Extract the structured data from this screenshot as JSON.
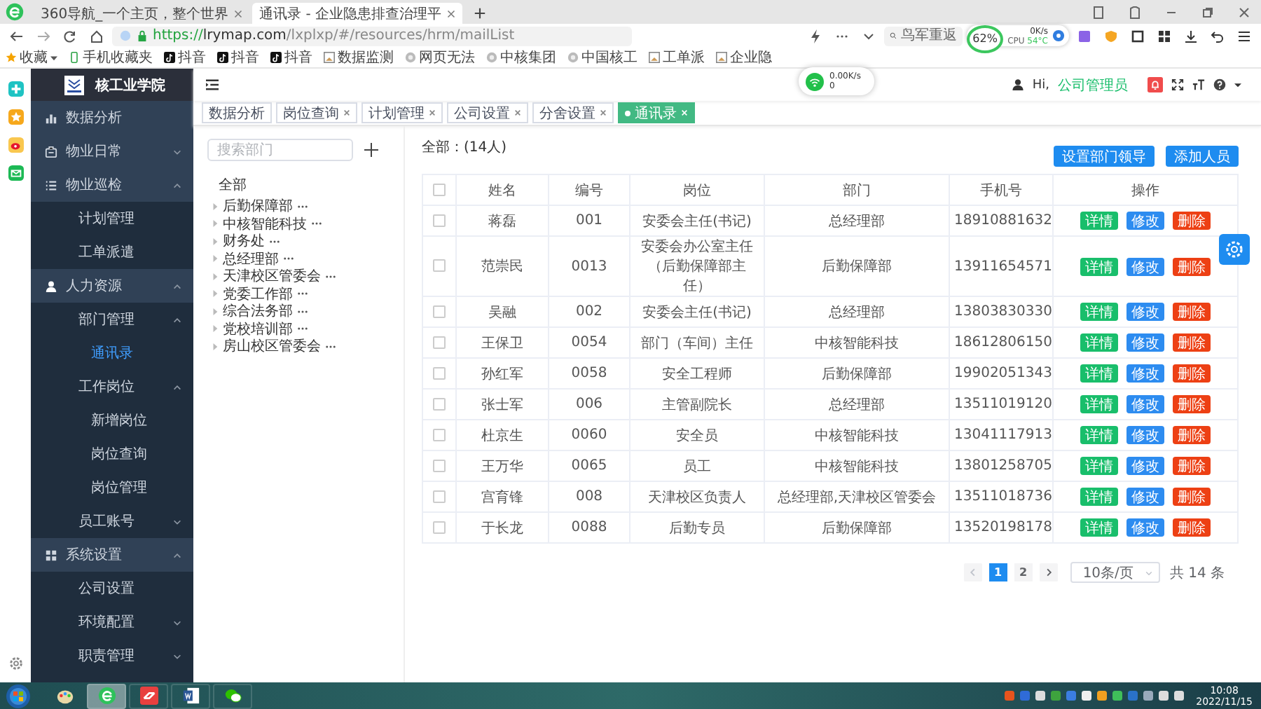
{
  "browser": {
    "tabs": [
      {
        "title": "360导航_一个主页，整个世界",
        "selected": false
      },
      {
        "title": "通讯录 - 企业隐患排查治理平",
        "selected": true
      }
    ],
    "url_scheme": "https://",
    "url_host": "lrymap.com",
    "url_path": "/lxplxp/#/resources/hrm/mailList",
    "search_placeholder": "鸟军重返",
    "monitor": {
      "percent": "62%",
      "speed": "0K/s",
      "cpu": "CPU",
      "temp": "54°C"
    },
    "bookmarks": [
      "收藏",
      "手机收藏夹",
      "抖音",
      "抖音",
      "抖音",
      "数据监测",
      "网页无法",
      "中核集团",
      "中国核工",
      "工单派",
      "企业隐"
    ]
  },
  "net_widget": {
    "speed": "0.00K/s",
    "count": "0"
  },
  "app": {
    "logo": "核工业学院",
    "sidebar": [
      {
        "label": "数据分析",
        "selected": false
      },
      {
        "label": "物业日常",
        "expanded": false,
        "selected": false
      },
      {
        "label": "物业巡检",
        "expanded": true,
        "selected": false,
        "children": [
          {
            "label": "计划管理",
            "selected": false
          },
          {
            "label": "工单派遣",
            "selected": false
          }
        ]
      },
      {
        "label": "人力资源",
        "expanded": true,
        "selected": false,
        "children": [
          {
            "label": "部门管理",
            "expanded": true,
            "selected": false,
            "children": [
              {
                "label": "通讯录",
                "selected": true
              }
            ]
          },
          {
            "label": "工作岗位",
            "expanded": true,
            "selected": false,
            "children": [
              {
                "label": "新增岗位",
                "selected": false
              },
              {
                "label": "岗位查询",
                "selected": false
              },
              {
                "label": "岗位管理",
                "selected": false
              }
            ]
          },
          {
            "label": "员工账号",
            "expanded": false,
            "selected": false
          }
        ]
      },
      {
        "label": "系统设置",
        "expanded": true,
        "selected": false,
        "children": [
          {
            "label": "公司设置",
            "selected": false
          },
          {
            "label": "环境配置",
            "expanded": false,
            "selected": false
          },
          {
            "label": "职责管理",
            "expanded": false,
            "selected": false
          }
        ]
      }
    ],
    "header": {
      "greeting": "Hi,",
      "user": "公司管理员"
    },
    "tags": [
      {
        "label": "数据分析",
        "closable": false,
        "selected": false
      },
      {
        "label": "岗位查询",
        "closable": true,
        "selected": false
      },
      {
        "label": "计划管理",
        "closable": true,
        "selected": false
      },
      {
        "label": "公司设置",
        "closable": true,
        "selected": false
      },
      {
        "label": "分舍设置",
        "closable": true,
        "selected": false
      },
      {
        "label": "通讯录",
        "closable": true,
        "selected": true
      }
    ],
    "tree": {
      "placeholder": "搜索部门",
      "root": "全部",
      "nodes": [
        {
          "label": "后勤保障部",
          "expanded": false
        },
        {
          "label": "中核智能科技",
          "expanded": false
        },
        {
          "label": "财务处",
          "expanded": false
        },
        {
          "label": "总经理部",
          "expanded": false
        },
        {
          "label": "天津校区管委会",
          "expanded": false
        },
        {
          "label": "党委工作部",
          "expanded": false
        },
        {
          "label": "综合法务部",
          "expanded": false
        },
        {
          "label": "党校培训部",
          "expanded": false
        },
        {
          "label": "房山校区管委会",
          "expanded": false
        }
      ]
    },
    "summary": "全部：(14人)",
    "buttons": [
      "设置部门领导",
      "添加人员"
    ],
    "table": {
      "all_checked": false,
      "columns": [
        "姓名",
        "编号",
        "岗位",
        "部门",
        "手机号",
        "操作"
      ],
      "rows": [
        {
          "checked": false,
          "name": "蒋磊",
          "code": "001",
          "post": "安委会主任(书记)",
          "dept": "总经理部",
          "phone": "18910881632",
          "actions": [
            "详情",
            "修改",
            "删除"
          ]
        },
        {
          "checked": false,
          "name": "范崇民",
          "code": "0013",
          "post": "安委会办公室主任（后勤保障部主任）",
          "dept": "后勤保障部",
          "phone": "13911654571",
          "actions": [
            "详情",
            "修改",
            "删除"
          ]
        },
        {
          "checked": false,
          "name": "吴融",
          "code": "002",
          "post": "安委会主任(书记)",
          "dept": "总经理部",
          "phone": "13803830330",
          "actions": [
            "详情",
            "修改",
            "删除"
          ]
        },
        {
          "checked": false,
          "name": "王保卫",
          "code": "0054",
          "post": "部门（车间）主任",
          "dept": "中核智能科技",
          "phone": "18612806150",
          "actions": [
            "详情",
            "修改",
            "删除"
          ]
        },
        {
          "checked": false,
          "name": "孙红军",
          "code": "0058",
          "post": "安全工程师",
          "dept": "后勤保障部",
          "phone": "19902051343",
          "actions": [
            "详情",
            "修改",
            "删除"
          ]
        },
        {
          "checked": false,
          "name": "张士军",
          "code": "006",
          "post": "主管副院长",
          "dept": "总经理部",
          "phone": "13511019120",
          "actions": [
            "详情",
            "修改",
            "删除"
          ]
        },
        {
          "checked": false,
          "name": "杜京生",
          "code": "0060",
          "post": "安全员",
          "dept": "中核智能科技",
          "phone": "13041117913",
          "actions": [
            "详情",
            "修改",
            "删除"
          ]
        },
        {
          "checked": false,
          "name": "王万华",
          "code": "0065",
          "post": "员工",
          "dept": "中核智能科技",
          "phone": "13801258705",
          "actions": [
            "详情",
            "修改",
            "删除"
          ]
        },
        {
          "checked": false,
          "name": "宫育锋",
          "code": "008",
          "post": "天津校区负责人",
          "dept": "总经理部,天津校区管委会",
          "phone": "13511018736",
          "actions": [
            "详情",
            "修改",
            "删除"
          ]
        },
        {
          "checked": false,
          "name": "于长龙",
          "code": "0088",
          "post": "后勤专员",
          "dept": "后勤保障部",
          "phone": "13520198178",
          "actions": [
            "详情",
            "修改",
            "删除"
          ]
        }
      ]
    },
    "pagination": {
      "pages": [
        {
          "label": "1",
          "selected": true
        },
        {
          "label": "2",
          "selected": false
        }
      ],
      "page_size": "10条/页",
      "total": "共 14 条"
    }
  },
  "taskbar": {
    "apps": [
      {
        "selected": false
      },
      {
        "selected": true
      },
      {
        "selected": false
      },
      {
        "selected": false
      },
      {
        "selected": false
      }
    ],
    "time": "10:08",
    "date": "2022/11/15"
  }
}
